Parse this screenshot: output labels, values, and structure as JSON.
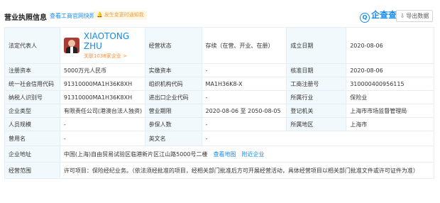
{
  "header": {
    "title": "营业执照信息",
    "official_link": "查看工商官网快照",
    "notify_badge": "发生变更时通知我",
    "brand": "企查查",
    "brand_icon": "Q",
    "export_label": "导出数据"
  },
  "legal_rep": {
    "label": "法定代表人",
    "name": "XIAOTONG ZHU",
    "related": "关联1038家企业 >"
  },
  "rows": {
    "status_label": "经营状态",
    "status_value": "存续（在营、开业、在册）",
    "founded_label": "成立日期",
    "founded_value": "2020-08-06",
    "reg_capital_label": "注册资本",
    "reg_capital_value": "5000万元人民币",
    "paid_capital_label": "实缴资本",
    "paid_capital_value": "-",
    "approval_label": "核准日期",
    "approval_value": "2020-08-06",
    "credit_code_label": "统一社会信用代码",
    "credit_code_value": "91310000MA1H36K8XH",
    "org_code_label": "组织机构代码",
    "org_code_value": "MA1H36K8-X",
    "biz_reg_label": "工商注册号",
    "biz_reg_value": "310000400956115",
    "taxpayer_label": "纳税人识别号",
    "taxpayer_value": "91310000MA1H36K8XH",
    "import_code_label": "进出口企业代码",
    "import_code_value": "-",
    "industry_label": "所属行业",
    "industry_value": "保险业",
    "type_label": "企业类型",
    "type_value": "有限责任公司(港澳台法人独资)",
    "term_label": "营业期限",
    "term_value": "2020-08-06 至 2050-08-05",
    "authority_label": "登记机关",
    "authority_value": "上海市市场监督管理局",
    "scale_label": "人员规模",
    "scale_value": "-",
    "insured_label": "参保人数",
    "insured_value": "-",
    "region_label": "所属地区",
    "region_value": "上海市",
    "former_name_label": "曾用名",
    "former_name_value": "-",
    "english_name_label": "英文名",
    "english_name_value": "-",
    "address_label": "企业地址",
    "address_value": "中国(上海)自由贸易试验区临港新片区江山路5000号二楼",
    "address_map_link": "查看地图",
    "address_nearby_link": "附近企业",
    "scope_label": "经营范围",
    "scope_value": "许可项目：保险经纪业务。（依法须经批准的项目，经相关部门批准后方可开展经营活动，具体经营项目以相关部门批准文件或许可证件为准）"
  }
}
